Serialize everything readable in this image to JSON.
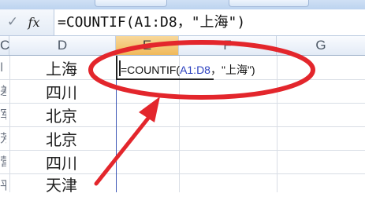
{
  "formula_bar": {
    "cancel_icon": "check-icon",
    "fx_label": "fx",
    "formula": "=COUNTIF(A1:D8，\"上海\")"
  },
  "column_headers": [
    "C",
    "D",
    "E",
    "F",
    "G"
  ],
  "active_column": "E",
  "rows": [
    {
      "c": "l",
      "d": "上海"
    },
    {
      "c": "差",
      "d": "四川"
    },
    {
      "c": "军",
      "d": "北京"
    },
    {
      "c": "芳",
      "d": "北京"
    },
    {
      "c": "营",
      "d": "四川"
    },
    {
      "c": "平",
      "d": "天津"
    }
  ],
  "active_cell": {
    "prefix": "=COUNTIF(",
    "ref": "A1:D8",
    "suffix": "，\"上海\")"
  },
  "annotation_colors": {
    "ellipse": "#e3262c",
    "arrow": "#e3262c"
  }
}
